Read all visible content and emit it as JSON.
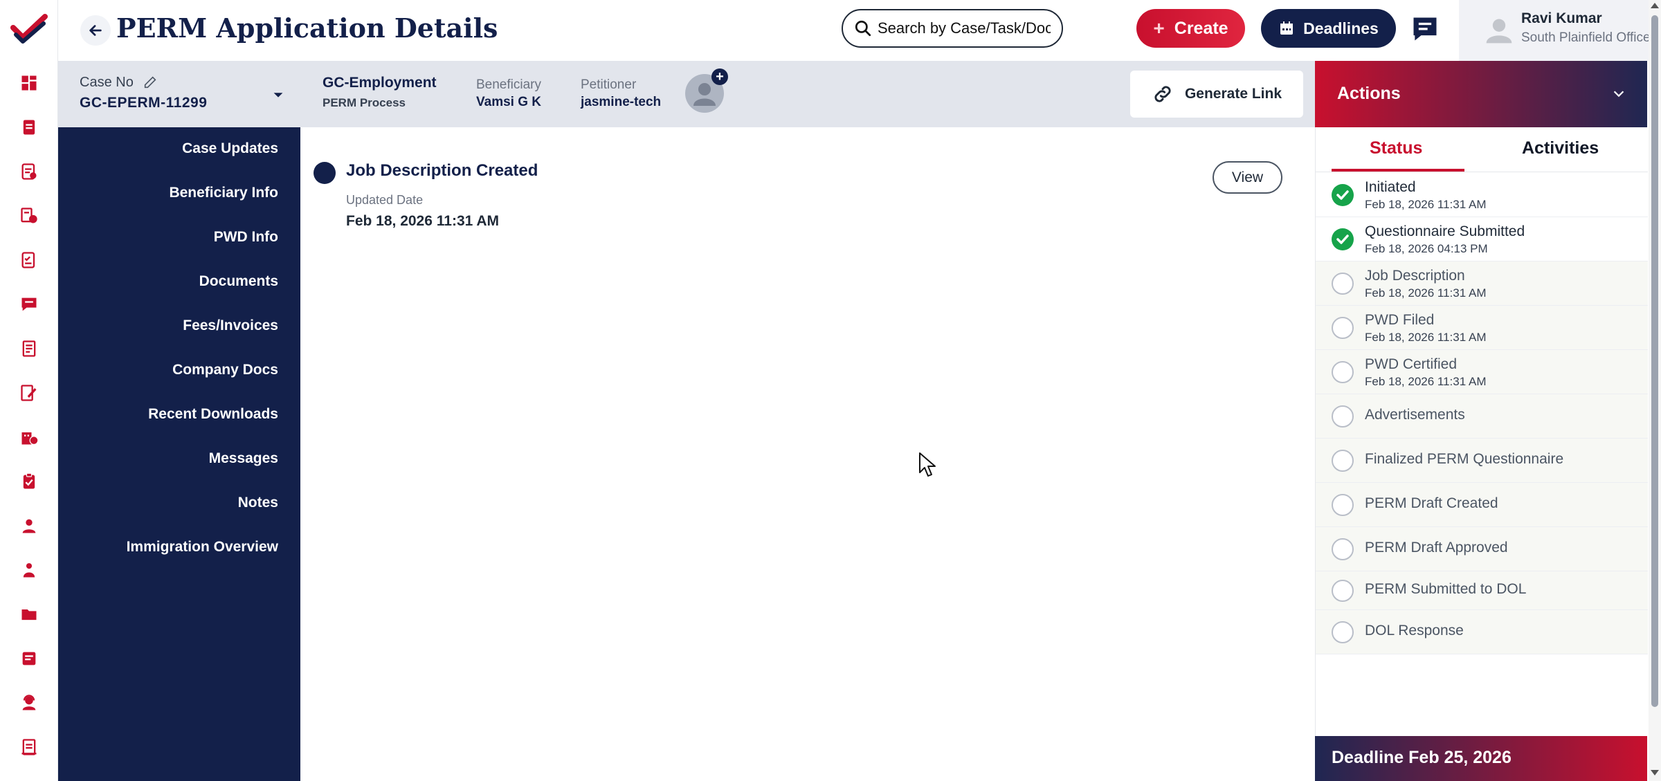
{
  "header": {
    "title": "PERM Application Details",
    "search_placeholder": "Search by Case/Task/Document",
    "create_label": "Create",
    "deadlines_label": "Deadlines",
    "user": {
      "name": "Ravi Kumar",
      "office": "South Plainfield Office"
    }
  },
  "case": {
    "case_no_label": "Case No",
    "case_no": "GC-EPERM-11299",
    "type": "GC-Employment",
    "process": "PERM Process",
    "beneficiary_label": "Beneficiary",
    "beneficiary": "Vamsi G K",
    "petitioner_label": "Petitioner",
    "petitioner": "jasmine-tech",
    "generate_link_label": "Generate Link"
  },
  "nav": {
    "items": [
      "Case Updates",
      "Beneficiary Info",
      "PWD Info",
      "Documents",
      "Fees/Invoices",
      "Company Docs",
      "Recent Downloads",
      "Messages",
      "Notes",
      "Immigration Overview"
    ]
  },
  "timeline": {
    "title": "Job Description Created",
    "date_label": "Updated Date",
    "date": "Feb 18, 2026 11:31 AM",
    "view_label": "View"
  },
  "actions": {
    "title": "Actions",
    "tabs": [
      "Status",
      "Activities"
    ],
    "steps": [
      {
        "name": "Initiated",
        "date": "Feb 18, 2026 11:31 AM",
        "done": true
      },
      {
        "name": "Questionnaire Submitted",
        "date": "Feb 18, 2026 04:13 PM",
        "done": true
      },
      {
        "name": "Job Description",
        "date": "Feb 18, 2026 11:31 AM",
        "done": false
      },
      {
        "name": "PWD Filed",
        "date": "Feb 18, 2026 11:31 AM",
        "done": false
      },
      {
        "name": "PWD Certified",
        "date": "Feb 18, 2026 11:31 AM",
        "done": false
      },
      {
        "name": "Advertisements",
        "date": "",
        "done": false
      },
      {
        "name": "Finalized PERM Questionnaire",
        "date": "",
        "done": false
      },
      {
        "name": "PERM Draft Created",
        "date": "",
        "done": false
      },
      {
        "name": "PERM Draft Approved",
        "date": "",
        "done": false
      },
      {
        "name": "PERM Submitted to DOL",
        "date": "",
        "done": false
      },
      {
        "name": "DOL Response",
        "date": "",
        "done": false
      }
    ],
    "deadline": "Deadline Feb 25, 2026"
  },
  "colors": {
    "navy": "#13204a",
    "brand_red": "#c8102e",
    "success": "#16a34a"
  },
  "rail_icons": [
    "dashboard-icon",
    "case-icon",
    "forms-icon",
    "tasks-icon",
    "checklist-icon",
    "chat-icon",
    "document-icon",
    "edit-document-icon",
    "building-icon",
    "clipboard-icon",
    "user-icon",
    "people-icon",
    "folder-icon",
    "note-icon",
    "support-icon",
    "report-icon"
  ]
}
